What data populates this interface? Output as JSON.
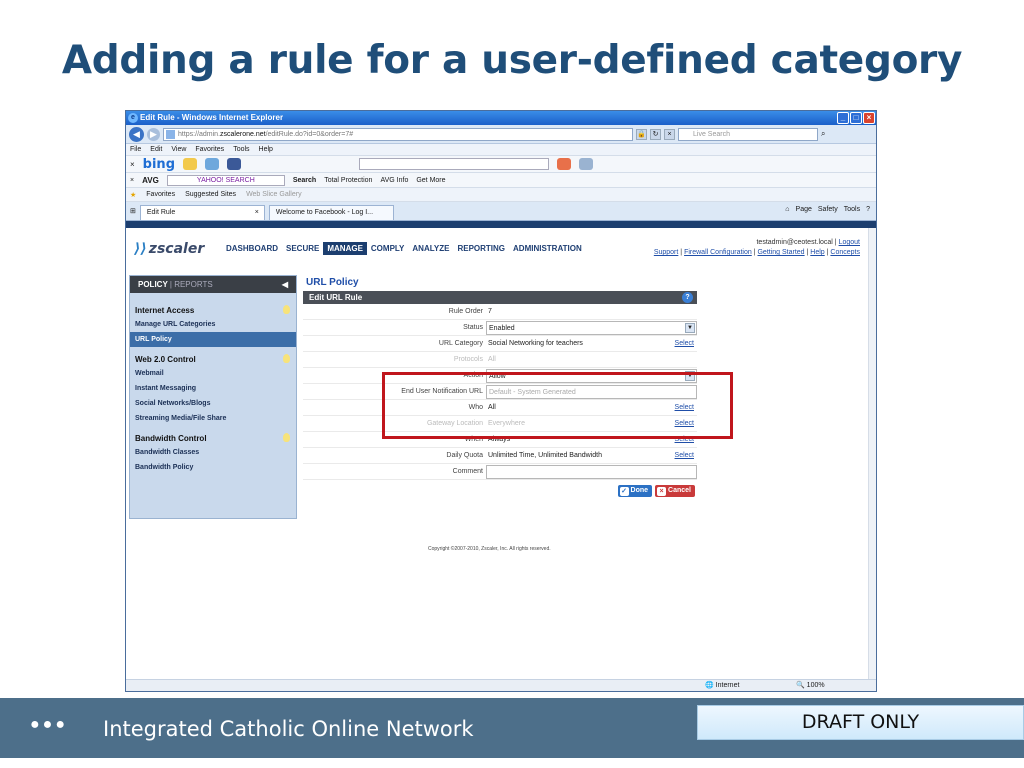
{
  "slide": {
    "title": "Adding a rule for a user-defined category",
    "footer_org": "Integrated Catholic Online Network",
    "footer_dots": "●●●",
    "draft_label": "DRAFT ONLY"
  },
  "browser": {
    "window_title": "Edit Rule - Windows Internet Explorer",
    "url_scheme": "https://admin.",
    "url_host": "zscalerone.net",
    "url_path": "/editRule.do?id=0&order=7#",
    "live_search_placeholder": "Live Search",
    "menu": [
      "File",
      "Edit",
      "View",
      "Favorites",
      "Tools",
      "Help"
    ],
    "bing_logo": "bing",
    "avg_logo": "AVG",
    "yahoo_label": "YAHOO! SEARCH",
    "avg_items": [
      "Search",
      "Total Protection",
      "AVG Info",
      "Get More"
    ],
    "favorites": [
      "Favorites",
      "Suggested Sites",
      "Web Slice Gallery"
    ],
    "tabs": [
      {
        "label": "Edit Rule"
      },
      {
        "label": "Welcome to Facebook - Log I..."
      }
    ],
    "tab_tools": [
      "Page",
      "Safety",
      "Tools"
    ],
    "status_internet": "Internet",
    "status_zoom": "100%"
  },
  "app": {
    "logo": "zscaler",
    "nav": [
      "DASHBOARD",
      "SECURE",
      "MANAGE",
      "COMPLY",
      "ANALYZE",
      "REPORTING",
      "ADMINISTRATION"
    ],
    "user": "testadmin@ceotest.local",
    "logout": "Logout",
    "links": [
      "Support",
      "Firewall Configuration",
      "Getting Started",
      "Help",
      "Concepts"
    ],
    "left_head_policy": "POLICY",
    "left_head_reports": "REPORTS",
    "sections": [
      {
        "title": "Internet Access",
        "items": [
          "Manage URL Categories",
          "URL Policy"
        ]
      },
      {
        "title": "Web 2.0 Control",
        "items": [
          "Webmail",
          "Instant Messaging",
          "Social Networks/Blogs",
          "Streaming Media/File Share"
        ]
      },
      {
        "title": "Bandwidth Control",
        "items": [
          "Bandwidth Classes",
          "Bandwidth Policy"
        ]
      }
    ],
    "page_title": "URL Policy",
    "form_title": "Edit URL Rule",
    "rows": {
      "rule_order": {
        "label": "Rule Order",
        "value": "7"
      },
      "status": {
        "label": "Status",
        "value": "Enabled"
      },
      "url_category": {
        "label": "URL Category",
        "value": "Social Networking for teachers",
        "link": "Select"
      },
      "protocols": {
        "label": "Protocols",
        "value": "All"
      },
      "action": {
        "label": "Action",
        "value": "Allow"
      },
      "notification": {
        "label": "End User Notification URL",
        "placeholder": "Default - System Generated"
      },
      "who": {
        "label": "Who",
        "value": "All",
        "link": "Select"
      },
      "gateway": {
        "label": "Gateway Location",
        "value": "Everywhere",
        "link": "Select"
      },
      "when": {
        "label": "When",
        "value": "Always",
        "link": "Select"
      },
      "daily_quota": {
        "label": "Daily Quota",
        "value": "Unlimited Time, Unlimited Bandwidth",
        "link": "Select"
      },
      "comment": {
        "label": "Comment",
        "value": ""
      }
    },
    "done_label": "Done",
    "cancel_label": "Cancel",
    "copyright": "Copyright ©2007-2010, Zscaler, Inc. All rights reserved."
  }
}
